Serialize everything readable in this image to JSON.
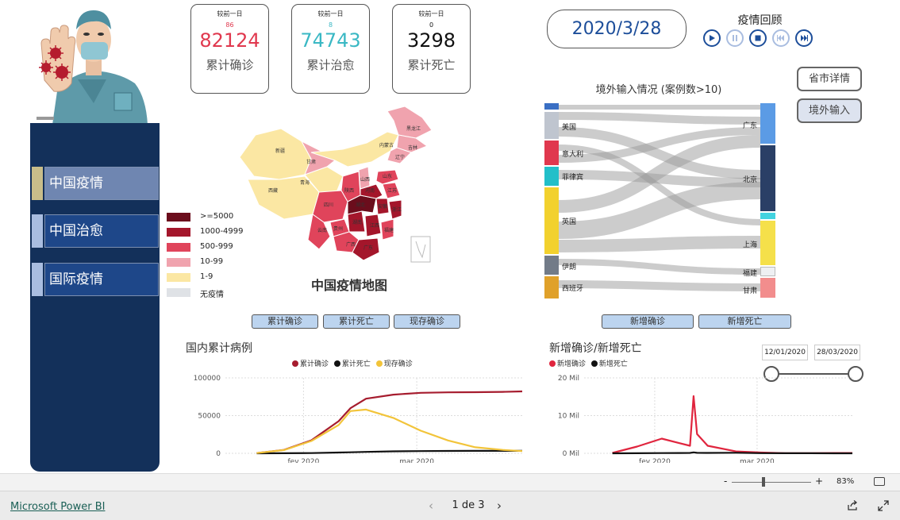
{
  "kpis": [
    {
      "top": "较前一日",
      "delta": "86",
      "value": "82124",
      "label": "累计确诊",
      "color": "#e0384e"
    },
    {
      "top": "较前一日",
      "delta": "8",
      "value": "74743",
      "label": "累计治愈",
      "color": "#3ab8c4"
    },
    {
      "top": "较前一日",
      "delta": "0",
      "value": "3298",
      "label": "累计死亡",
      "color": "#111111"
    }
  ],
  "date": "2020/3/28",
  "replay": {
    "title": "疫情回顾"
  },
  "side_buttons": {
    "province": "省市详情",
    "imported": "境外输入"
  },
  "nav": [
    {
      "label": "中国疫情",
      "marker": "#c8bd8a",
      "face": "#6f86b1"
    },
    {
      "label": "中国治愈",
      "marker": "#a9bde0",
      "face": "#1e4789"
    },
    {
      "label": "国际疫情",
      "marker": "#a9bde0",
      "face": "#1e4789"
    }
  ],
  "map": {
    "title": "中国疫情地图",
    "legend": [
      {
        "label": ">=5000",
        "color": "#6b0d1c"
      },
      {
        "label": "1000-4999",
        "color": "#a4162b"
      },
      {
        "label": "500-999",
        "color": "#e0445b"
      },
      {
        "label": "10-99",
        "color": "#f0a3ae"
      },
      {
        "label": "1-9",
        "color": "#fbe7a3"
      },
      {
        "label": "无疫情",
        "color": "#dfe2e6"
      }
    ],
    "provinces": [
      "新疆",
      "西藏",
      "青海",
      "甘肃",
      "内蒙古",
      "黑龙江",
      "吉林",
      "辽宁",
      "山西",
      "陕西",
      "四川",
      "云南",
      "贵州",
      "广西",
      "广东",
      "湖南",
      "湖北",
      "河南",
      "山东",
      "江苏",
      "安徽",
      "江西",
      "福建",
      "浙江"
    ]
  },
  "map_slicers": [
    "累计确诊",
    "累计死亡",
    "现存确诊"
  ],
  "sankey": {
    "title": "境外输入情况 (案例数>10)",
    "sources": [
      {
        "label": "美国",
        "color": "#bfc5cf"
      },
      {
        "label": "意大利",
        "color": "#e0384e"
      },
      {
        "label": "菲律宾",
        "color": "#22bfc9"
      },
      {
        "label": "英国",
        "color": "#f2d12e"
      },
      {
        "label": "伊朗",
        "color": "#727b88"
      },
      {
        "label": "西班牙",
        "color": "#e0a12a"
      }
    ],
    "targets": [
      {
        "label": "广东",
        "color": "#5b9be5"
      },
      {
        "label": "北京",
        "color": "#2a3f66"
      },
      {
        "label": "上海",
        "color": "#f5e04a"
      },
      {
        "label": "福建",
        "color": "#eef0f3"
      },
      {
        "label": "甘肃",
        "color": "#f28d8d"
      }
    ]
  },
  "sankey_slicers": [
    "新增确诊",
    "新增死亡"
  ],
  "line1": {
    "title": "国内累计病例",
    "legend": [
      {
        "label": "累计确诊",
        "color": "#a61c2e"
      },
      {
        "label": "累计死亡",
        "color": "#111111"
      },
      {
        "label": "现存确诊",
        "color": "#f2c43a"
      }
    ]
  },
  "line2": {
    "title": "新增确诊/新增死亡",
    "legend": [
      {
        "label": "新增确诊",
        "color": "#e0253e"
      },
      {
        "label": "新增死亡",
        "color": "#111111"
      }
    ],
    "range_from": "12/01/2020",
    "range_to": "28/03/2020"
  },
  "chart_data": [
    {
      "type": "line",
      "title": "国内累计病例",
      "x": [
        "2020-01-20",
        "2020-01-27",
        "2020-02-03",
        "2020-02-10",
        "2020-02-13",
        "2020-02-17",
        "2020-02-24",
        "2020-03-02",
        "2020-03-09",
        "2020-03-16",
        "2020-03-23",
        "2020-03-28"
      ],
      "x_ticks": [
        "fev 2020",
        "mar 2020"
      ],
      "y_ticks": [
        "0",
        "50000",
        "100000"
      ],
      "ylim": [
        0,
        100000
      ],
      "series": [
        {
          "name": "累计确诊",
          "color": "#a61c2e",
          "values": [
            300,
            4500,
            17200,
            42600,
            59800,
            72400,
            77800,
            80200,
            80800,
            81100,
            81500,
            82124
          ]
        },
        {
          "name": "累计死亡",
          "color": "#111111",
          "values": [
            6,
            106,
            361,
            1016,
            1370,
            1868,
            2592,
            2915,
            3123,
            3217,
            3274,
            3298
          ]
        },
        {
          "name": "现存确诊",
          "color": "#f2c43a",
          "values": [
            280,
            4300,
            16300,
            37600,
            56000,
            58000,
            47000,
            30000,
            17000,
            8000,
            4500,
            3000
          ]
        }
      ]
    },
    {
      "type": "line",
      "title": "新增确诊/新增死亡",
      "x": [
        "2020-01-20",
        "2020-01-27",
        "2020-02-03",
        "2020-02-08",
        "2020-02-11",
        "2020-02-12",
        "2020-02-13",
        "2020-02-16",
        "2020-02-24",
        "2020-03-02",
        "2020-03-09",
        "2020-03-16",
        "2020-03-23",
        "2020-03-28"
      ],
      "x_ticks": [
        "fev 2020",
        "mar 2020"
      ],
      "y_ticks": [
        "0 Mil",
        "10 Mil",
        "20 Mil"
      ],
      "ylim": [
        0,
        20000
      ],
      "series": [
        {
          "name": "新增确诊",
          "color": "#e0253e",
          "values": [
            100,
            1800,
            3900,
            2700,
            2000,
            15150,
            5100,
            2000,
            500,
            200,
            40,
            30,
            80,
            80
          ]
        },
        {
          "name": "新增死亡",
          "color": "#111111",
          "values": [
            0,
            30,
            60,
            90,
            100,
            250,
            120,
            100,
            150,
            40,
            20,
            15,
            8,
            5
          ]
        }
      ]
    }
  ],
  "zoom": {
    "value": "83%"
  },
  "footer": {
    "brand": "Microsoft Power BI",
    "pager": "1 de 3"
  }
}
